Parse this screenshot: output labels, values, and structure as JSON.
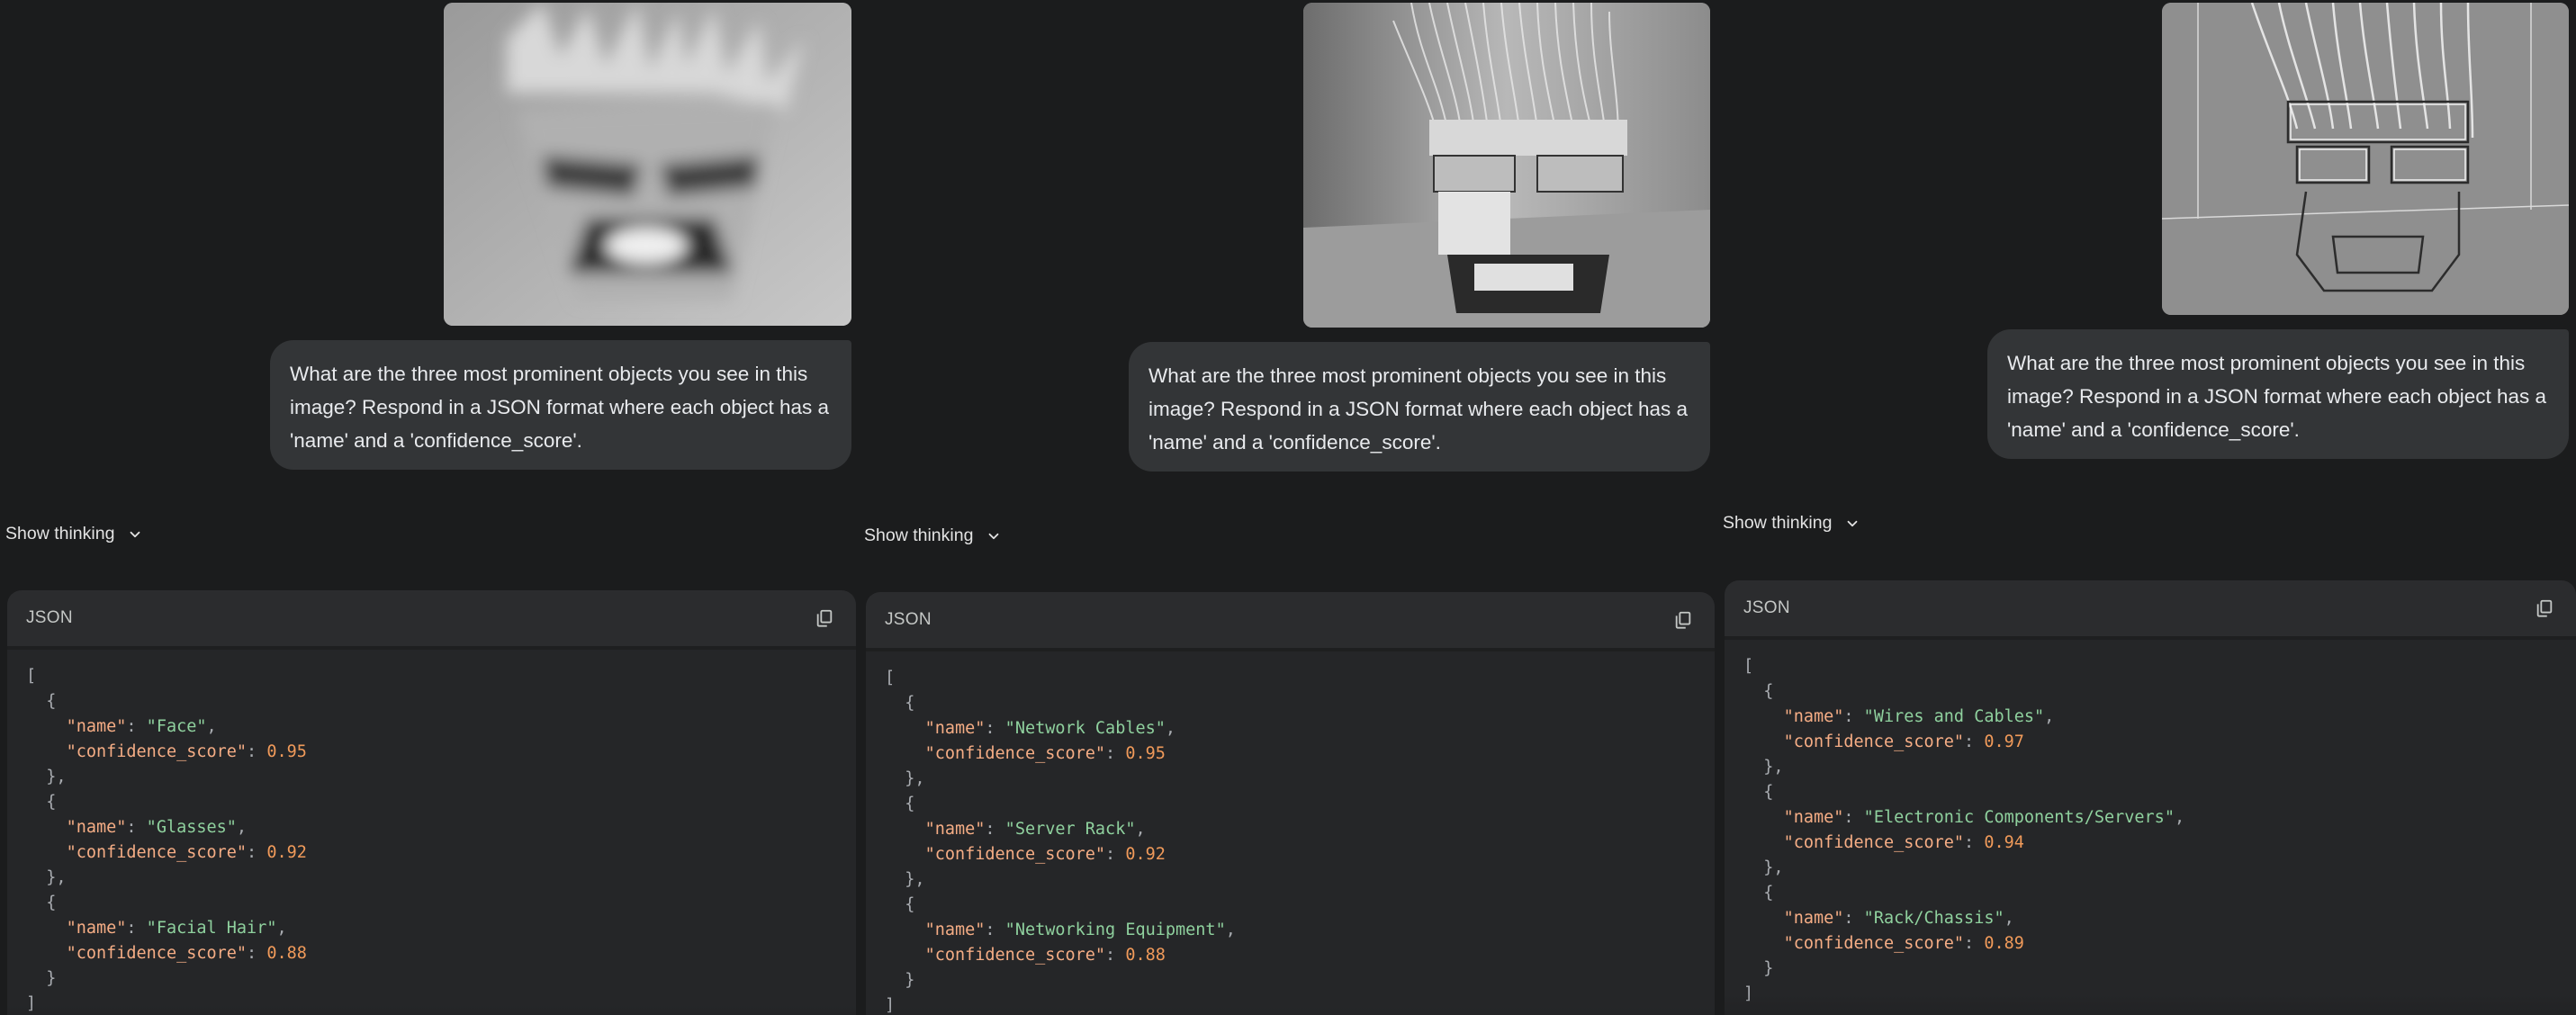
{
  "columns": [
    {
      "image_icon": "image-face-blurred",
      "prompt": "What are the three most prominent objects you see in this image? Respond in a JSON format where each object has a 'name' and a 'confidence_score'.",
      "thinking_label": "Show thinking",
      "code_lang": "JSON",
      "objects": [
        {
          "name": "Face",
          "confidence_score": "0.95"
        },
        {
          "name": "Glasses",
          "confidence_score": "0.92"
        },
        {
          "name": "Facial Hair",
          "confidence_score": "0.88"
        }
      ]
    },
    {
      "image_icon": "image-server-rack-photo",
      "prompt": "What are the three most prominent objects you see in this image? Respond in a JSON format where each object has a 'name' and a 'confidence_score'.",
      "thinking_label": "Show thinking",
      "code_lang": "JSON",
      "objects": [
        {
          "name": "Network Cables",
          "confidence_score": "0.95"
        },
        {
          "name": "Server Rack",
          "confidence_score": "0.92"
        },
        {
          "name": "Networking Equipment",
          "confidence_score": "0.88"
        }
      ]
    },
    {
      "image_icon": "image-server-rack-edges",
      "prompt": "What are the three most prominent objects you see in this image? Respond in a JSON format where each object has a 'name' and a 'confidence_score'.",
      "thinking_label": "Show thinking",
      "code_lang": "JSON",
      "objects": [
        {
          "name": "Wires and Cables",
          "confidence_score": "0.97"
        },
        {
          "name": "Electronic Components/Servers",
          "confidence_score": "0.94"
        },
        {
          "name": "Rack/Chassis",
          "confidence_score": "0.89"
        }
      ]
    }
  ],
  "json_tokens": {
    "open_bracket": "[",
    "close_bracket": "]",
    "open_brace": "{",
    "close_brace": "}",
    "close_brace_comma": "},",
    "name_key": "\"name\"",
    "score_key": "\"confidence_score\""
  },
  "colors": {
    "background": "#1b1c1d",
    "bubble": "#333537",
    "code_header": "#2b2c2e",
    "code_body": "#252628",
    "string": "#8fd19e",
    "number": "#f09a5a",
    "key": "#f5ad85"
  }
}
